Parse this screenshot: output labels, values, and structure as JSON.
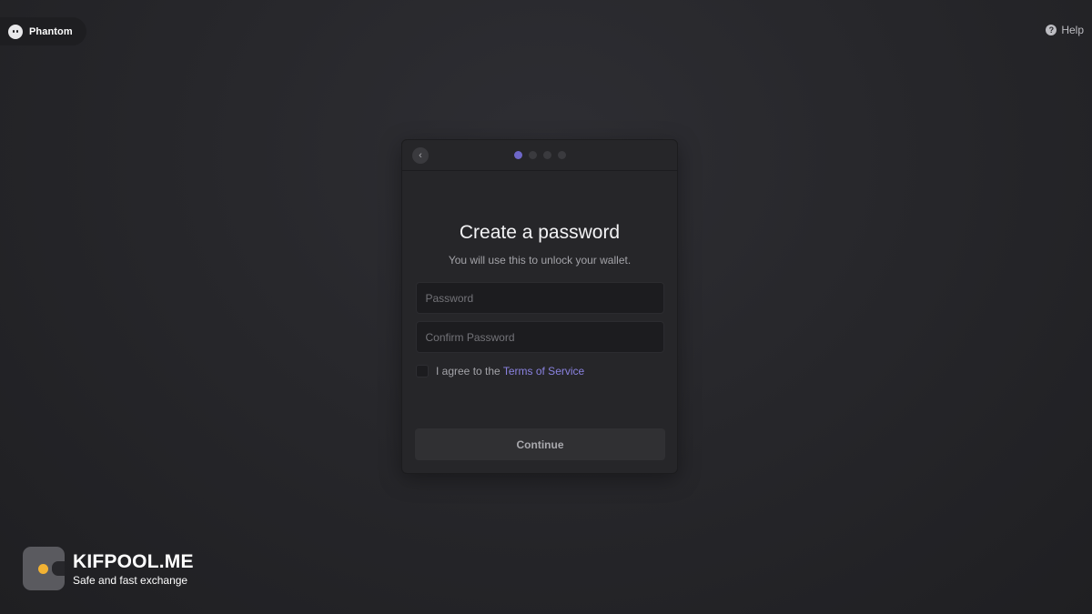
{
  "brand": {
    "name": "Phantom",
    "icon": "ghost-icon"
  },
  "help": {
    "label": "Help",
    "icon": "question-circle-icon",
    "icon_glyph": "?"
  },
  "card": {
    "back_icon": "chevron-left-icon",
    "back_glyph": "‹",
    "steps": {
      "total": 4,
      "current": 1
    },
    "title": "Create a password",
    "subtitle": "You will use this to unlock your wallet.",
    "password": {
      "value": "",
      "placeholder": "Password"
    },
    "confirm_password": {
      "value": "",
      "placeholder": "Confirm Password"
    },
    "agree": {
      "checked": false,
      "text": "I agree to the",
      "link_text": "Terms of Service"
    },
    "continue_label": "Continue"
  },
  "watermark": {
    "name": "KIFPOOL.ME",
    "tagline": "Safe and fast exchange"
  },
  "colors": {
    "background": "#27272b",
    "card": "#262629",
    "accent": "#6e67c8",
    "link": "#8a82e0",
    "watermark_dot": "#f2b233"
  }
}
